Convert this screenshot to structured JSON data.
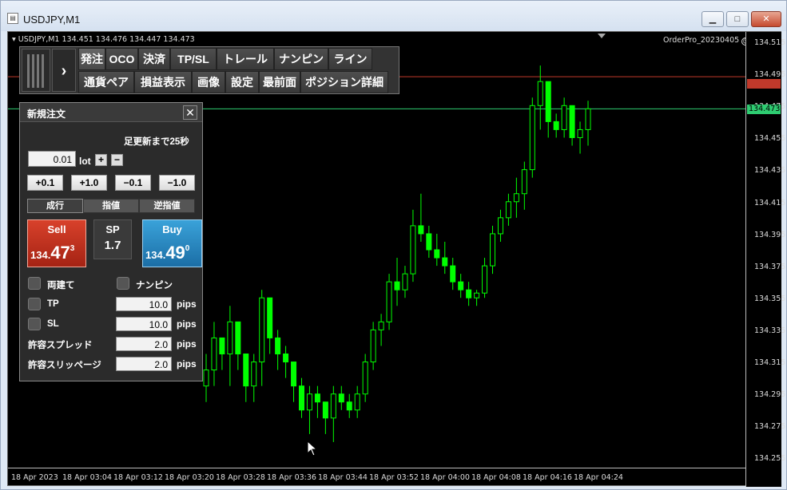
{
  "window": {
    "title": "USDJPY,M1",
    "minimize": "▁",
    "maximize": "□",
    "close": "✕"
  },
  "chart": {
    "info": "USDJPY,M1  134.451 134.476 134.447 134.473",
    "ea_label": "OrderPro_20230405",
    "price_labels": [
      "134.515",
      "134.495",
      "134.475",
      "134.455",
      "134.435",
      "134.415",
      "134.395",
      "134.375",
      "134.355",
      "134.335",
      "134.315",
      "134.295",
      "134.275",
      "134.255"
    ],
    "time_labels": [
      "18 Apr 2023",
      "18 Apr 03:04",
      "18 Apr 03:12",
      "18 Apr 03:20",
      "18 Apr 03:28",
      "18 Apr 03:36",
      "18 Apr 03:44",
      "18 Apr 03:52",
      "18 Apr 04:00",
      "18 Apr 04:08",
      "18 Apr 04:16",
      "18 Apr 04:24"
    ],
    "bid_tag": "134.473",
    "ask_line_color": "#c0392b",
    "bid_line_color": "#2ecc71",
    "candle_color": "#00ff00"
  },
  "chart_data": {
    "type": "candlestick",
    "symbol": "USDJPY",
    "timeframe": "M1",
    "ylim": [
      134.255,
      134.515
    ],
    "bid": 134.473,
    "ask": 134.493,
    "candles": [
      [
        134.3,
        134.32,
        134.29,
        134.31
      ],
      [
        134.31,
        134.34,
        134.3,
        134.33
      ],
      [
        134.33,
        134.32,
        134.31,
        134.32
      ],
      [
        134.32,
        134.35,
        134.3,
        134.34
      ],
      [
        134.34,
        134.33,
        134.31,
        134.32
      ],
      [
        134.32,
        134.31,
        134.29,
        134.3
      ],
      [
        134.3,
        134.32,
        134.29,
        134.315
      ],
      [
        134.315,
        134.36,
        134.3,
        134.355
      ],
      [
        134.355,
        134.34,
        134.32,
        134.33
      ],
      [
        134.33,
        134.335,
        134.31,
        134.32
      ],
      [
        134.32,
        134.325,
        134.305,
        134.315
      ],
      [
        134.315,
        134.31,
        134.29,
        134.3
      ],
      [
        134.3,
        134.305,
        134.28,
        134.285
      ],
      [
        134.285,
        134.3,
        134.27,
        134.295
      ],
      [
        134.295,
        134.3,
        134.28,
        134.29
      ],
      [
        134.29,
        134.285,
        134.27,
        134.28
      ],
      [
        134.28,
        134.3,
        134.265,
        134.295
      ],
      [
        134.295,
        134.3,
        134.285,
        134.29
      ],
      [
        134.29,
        134.295,
        134.28,
        134.285
      ],
      [
        134.285,
        134.3,
        134.28,
        134.295
      ],
      [
        134.295,
        134.32,
        134.29,
        134.315
      ],
      [
        134.315,
        134.34,
        134.31,
        134.335
      ],
      [
        134.335,
        134.345,
        134.325,
        134.34
      ],
      [
        134.34,
        134.37,
        134.335,
        134.365
      ],
      [
        134.365,
        134.38,
        134.35,
        134.36
      ],
      [
        134.36,
        134.375,
        134.355,
        134.37
      ],
      [
        134.37,
        134.41,
        134.365,
        134.4
      ],
      [
        134.4,
        134.42,
        134.39,
        134.395
      ],
      [
        134.395,
        134.4,
        134.38,
        134.385
      ],
      [
        134.385,
        134.395,
        134.375,
        134.38
      ],
      [
        134.38,
        134.39,
        134.37,
        134.375
      ],
      [
        134.375,
        134.38,
        134.36,
        134.365
      ],
      [
        134.365,
        134.37,
        134.355,
        134.36
      ],
      [
        134.36,
        134.365,
        134.35,
        134.355
      ],
      [
        134.355,
        134.36,
        134.35,
        134.358
      ],
      [
        134.358,
        134.38,
        134.355,
        134.375
      ],
      [
        134.375,
        134.4,
        134.37,
        134.395
      ],
      [
        134.395,
        134.41,
        134.39,
        134.405
      ],
      [
        134.405,
        134.42,
        134.4,
        134.415
      ],
      [
        134.415,
        134.43,
        134.405,
        134.42
      ],
      [
        134.42,
        134.44,
        134.41,
        134.435
      ],
      [
        134.435,
        134.48,
        134.43,
        134.475
      ],
      [
        134.475,
        134.5,
        134.46,
        134.49
      ],
      [
        134.49,
        134.485,
        134.455,
        134.465
      ],
      [
        134.465,
        134.47,
        134.455,
        134.46
      ],
      [
        134.46,
        134.48,
        134.455,
        134.475
      ],
      [
        134.475,
        134.47,
        134.45,
        134.455
      ],
      [
        134.455,
        134.465,
        134.445,
        134.46
      ],
      [
        134.46,
        134.478,
        134.45,
        134.473
      ]
    ]
  },
  "toolbar": {
    "row1": [
      "発注",
      "OCO",
      "決済",
      "TP/SL",
      "トレール",
      "ナンピン",
      "ライン"
    ],
    "row2": [
      "通貨ペア",
      "損益表示",
      "画像",
      "設定",
      "最前面",
      "ポジション詳細"
    ],
    "toggle": "›"
  },
  "panel": {
    "title": "新規注文",
    "close": "✕",
    "refresh": "足更新まで25秒",
    "lot_value": "0.01",
    "lot_label": "lot",
    "plus": "+",
    "minus": "−",
    "inc": [
      "+0.1",
      "+1.0",
      "−0.1",
      "−1.0"
    ],
    "tabs": [
      "成行",
      "指値",
      "逆指値"
    ],
    "sell": {
      "caption": "Sell",
      "price_small": "134.",
      "price_big": "47",
      "price_sup": "3"
    },
    "spread": {
      "caption": "SP",
      "value": "1.7"
    },
    "buy": {
      "caption": "Buy",
      "price_small": "134.",
      "price_big": "49",
      "price_sup": "0"
    },
    "hedge_label": "両建て",
    "nanpin_label": "ナンピン",
    "tp_label": "TP",
    "tp_value": "10.0",
    "sl_label": "SL",
    "sl_value": "10.0",
    "spread_allow_label": "許容スプレッド",
    "spread_allow_value": "2.0",
    "slippage_label": "許容スリッページ",
    "slippage_value": "2.0",
    "unit": "pips"
  }
}
